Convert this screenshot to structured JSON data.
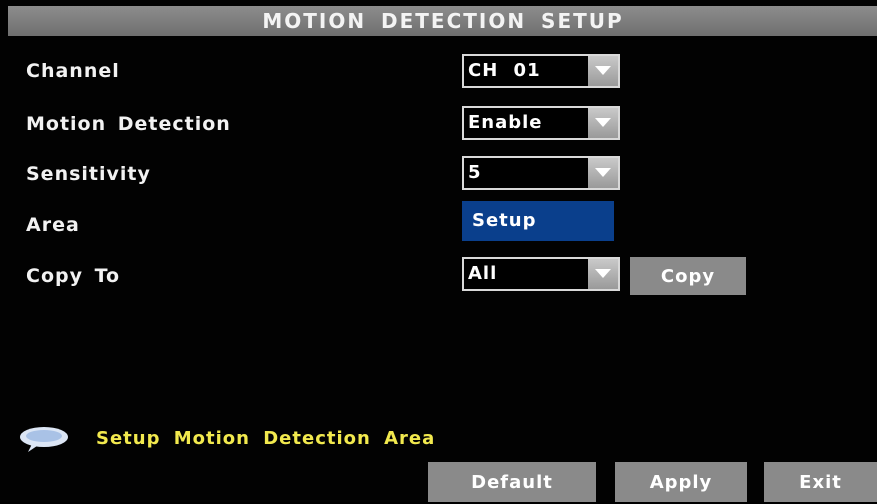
{
  "title": "MOTION DETECTION SETUP",
  "rows": [
    {
      "label": "Channel",
      "value": "CH 01",
      "control": "dropdown"
    },
    {
      "label": "Motion Detection",
      "value": "Enable",
      "control": "dropdown"
    },
    {
      "label": "Sensitivity",
      "value": "5",
      "control": "dropdown"
    },
    {
      "label": "Area",
      "value": "Setup",
      "control": "button"
    },
    {
      "label": "Copy To",
      "value": "All",
      "control": "dropdown"
    }
  ],
  "copy_button": "Copy",
  "hint": {
    "icon": "speech-bubble-icon",
    "text": "Setup Motion Detection Area"
  },
  "footer": {
    "default_label": "Default",
    "apply_label": "Apply",
    "exit_label": "Exit"
  },
  "colors": {
    "background": "#020202",
    "title_bar": "#7d7d7d",
    "selected_button": "#0a3f8c",
    "hint_text": "#f2e94e",
    "button_gray": "#8a8a8a"
  }
}
